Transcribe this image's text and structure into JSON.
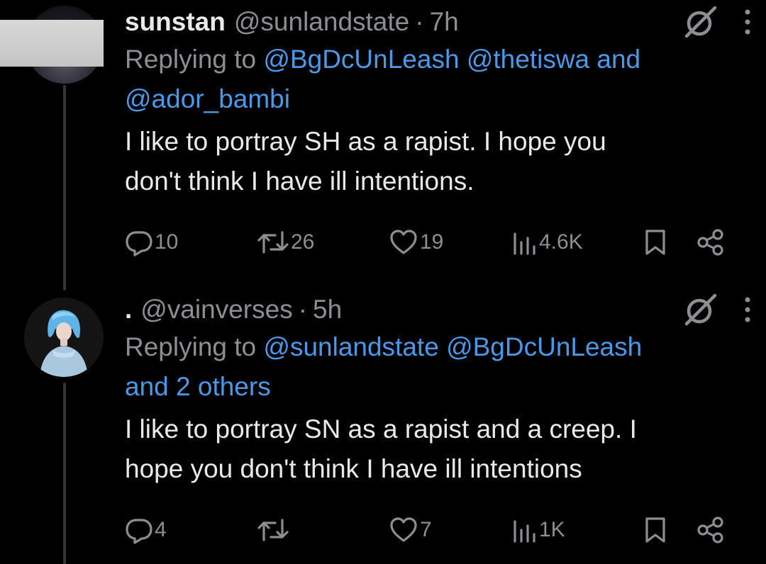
{
  "tweets": [
    {
      "name": "sunstan",
      "handle": "@sunlandstate",
      "separator": "·",
      "time": "7h",
      "replying_label": "Replying to",
      "mentions": [
        "@BgDcUnLeash",
        "@thetiswa"
      ],
      "conjunction": "and",
      "mention_last": "@ador_bambi",
      "text_line1": "I like to portray SH as a rapist. I hope you",
      "text_line2": "don't think I have ill intentions.",
      "replies": "10",
      "reposts": "26",
      "likes": "19",
      "views": "4.6K"
    },
    {
      "name": ".",
      "handle": "@vainverses",
      "separator": "·",
      "time": "5h",
      "replying_label": "Replying to",
      "mentions": [
        "@sunlandstate",
        "@BgDcUnLeash"
      ],
      "others": "and 2 others",
      "text_line1": "I like to portray SN as a rapist and a creep. I",
      "text_line2": "hope you don't think I have ill intentions",
      "replies": "4",
      "reposts": "",
      "likes": "7",
      "views": "1K"
    }
  ],
  "colors": {
    "background": "#000000",
    "text": "#e7e9ea",
    "secondary": "#8b8f94",
    "link": "#4a99e9",
    "thread_line": "#333639"
  },
  "icons": [
    "grok-icon",
    "more-icon",
    "reply-icon",
    "repost-icon",
    "like-icon",
    "views-icon",
    "bookmark-icon",
    "share-icon"
  ]
}
